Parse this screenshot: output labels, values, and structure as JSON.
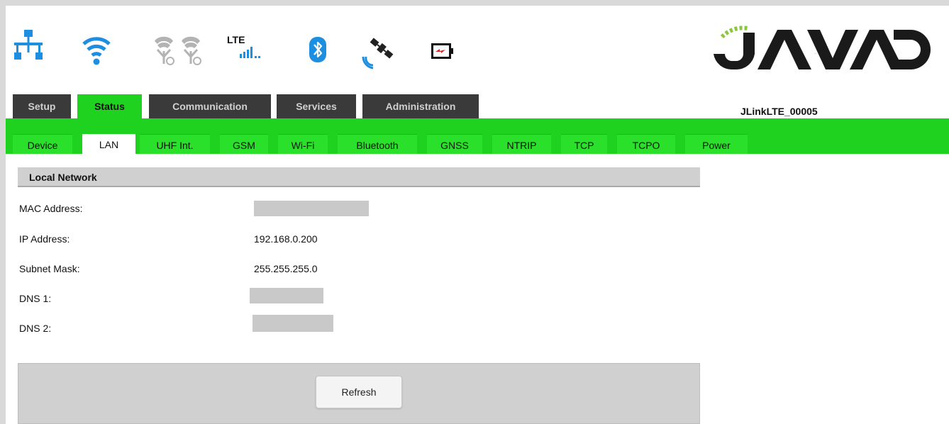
{
  "header": {
    "lte_label": "LTE",
    "brand": "JAVAD",
    "device_id": "JLinkLTE_00005",
    "icons": [
      "lan-icon",
      "wifi-icon",
      "uhf-antenna-icon",
      "uhf-antenna-icon",
      "lte-signal-icon",
      "bluetooth-icon",
      "satellite-icon",
      "battery-icon"
    ]
  },
  "top_tabs": [
    {
      "label": "Setup",
      "active": false
    },
    {
      "label": "Status",
      "active": true
    },
    {
      "label": "Communication",
      "active": false
    },
    {
      "label": "Services",
      "active": false
    },
    {
      "label": "Administration",
      "active": false
    }
  ],
  "sub_tabs": [
    {
      "label": "Device",
      "active": false
    },
    {
      "label": "LAN",
      "active": true
    },
    {
      "label": "UHF Int.",
      "active": false
    },
    {
      "label": "GSM",
      "active": false
    },
    {
      "label": "Wi-Fi",
      "active": false
    },
    {
      "label": "Bluetooth",
      "active": false
    },
    {
      "label": "GNSS",
      "active": false
    },
    {
      "label": "NTRIP",
      "active": false
    },
    {
      "label": "TCP",
      "active": false
    },
    {
      "label": "TCPO",
      "active": false
    },
    {
      "label": "Power",
      "active": false
    }
  ],
  "section": {
    "title": "Local Network",
    "rows": [
      {
        "label": "MAC Address:",
        "value": ""
      },
      {
        "label": "IP Address:",
        "value": "192.168.0.200"
      },
      {
        "label": "Subnet Mask:",
        "value": "255.255.255.0"
      },
      {
        "label": "DNS 1:",
        "value": ""
      },
      {
        "label": "DNS 2:",
        "value": ""
      }
    ]
  },
  "actions": {
    "refresh_label": "Refresh"
  },
  "colors": {
    "accent": "#1fd21f",
    "tab_dark": "#3a3a3a",
    "icon_blue": "#1e8fe0",
    "brand_green": "#8cc63f"
  }
}
